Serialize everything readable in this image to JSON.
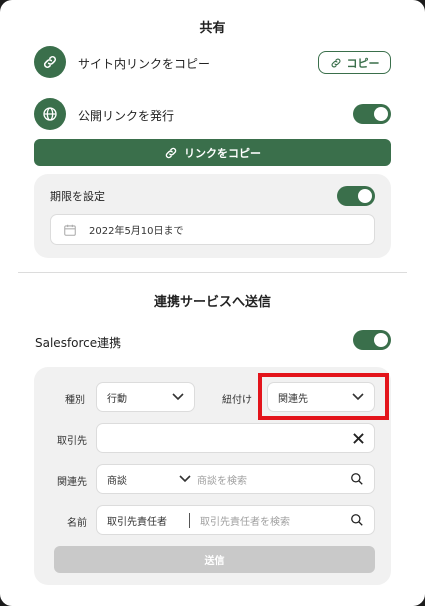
{
  "share": {
    "title": "共有",
    "copy_site_link_label": "サイト内リンクをコピー",
    "copy_button_label": "コピー",
    "public_link_label": "公開リンクを発行",
    "public_link_enabled": true,
    "copy_link_button_label": "リンクをコピー",
    "expiry": {
      "label": "期限を設定",
      "enabled": true,
      "date_value": "2022年5月10日まで"
    }
  },
  "integration": {
    "title": "連携サービスへ送信",
    "salesforce_label": "Salesforce連携",
    "salesforce_enabled": true,
    "form": {
      "type_label": "種別",
      "type_value": "行動",
      "link_label": "紐付け",
      "link_value": "関連先",
      "account_label": "取引先",
      "account_value": "",
      "related_label": "関連先",
      "related_select_value": "商談",
      "related_placeholder": "商談を検索",
      "name_label": "名前",
      "name_select_value": "取引先責任者",
      "name_placeholder": "取引先責任者を検索",
      "submit_label": "送信"
    }
  },
  "colors": {
    "brand_green": "#3a6f4b",
    "highlight_red": "#e3141b"
  }
}
